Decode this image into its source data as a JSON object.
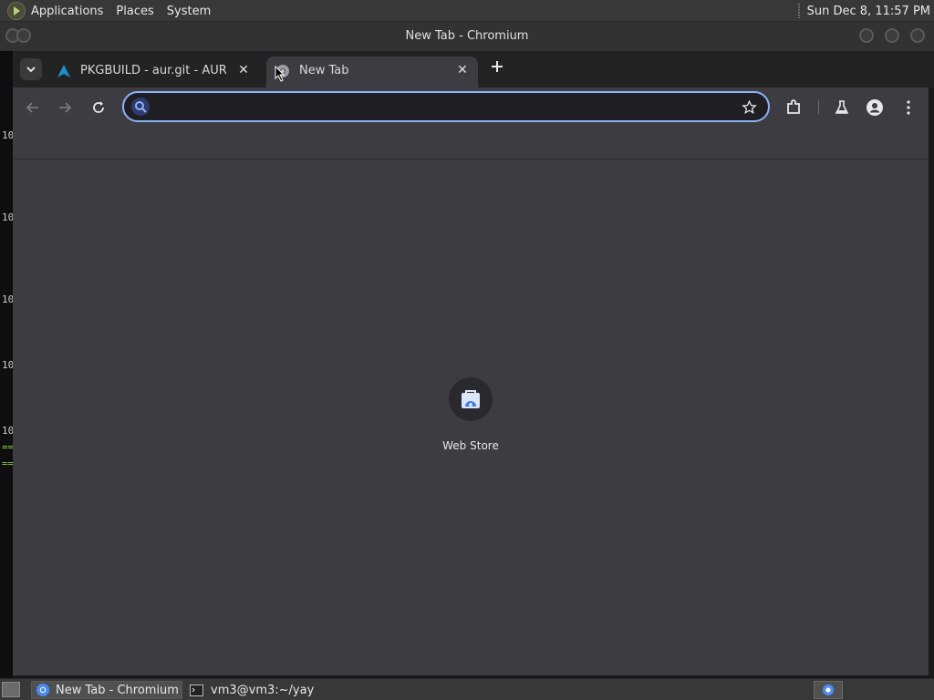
{
  "topbar": {
    "menus": [
      "Applications",
      "Places",
      "System"
    ],
    "clock": "Sun Dec  8, 11:57 PM"
  },
  "window": {
    "title": "New Tab - Chromium"
  },
  "tabs": [
    {
      "label": "PKGBUILD - aur.git - AUR Pa",
      "active": false,
      "favicon": "arch-linux-icon"
    },
    {
      "label": "New Tab",
      "active": true,
      "favicon": "chromium-globe-icon"
    }
  ],
  "omnibox": {
    "value": "",
    "placeholder": ""
  },
  "shortcuts": [
    {
      "label": "Web Store",
      "icon": "web-store-icon"
    }
  ],
  "taskbar": {
    "items": [
      {
        "label": "New Tab - Chromium",
        "active": true
      },
      {
        "label": "vm3@vm3:~/yay",
        "active": false
      }
    ]
  },
  "behind_terminal": {
    "line_fragments": [
      "10",
      "10",
      "10",
      "10",
      "10",
      "==",
      "=="
    ]
  },
  "colors": {
    "accent": "#8ab4f8",
    "background": "#3c3c41",
    "tabstrip": "#232323"
  }
}
